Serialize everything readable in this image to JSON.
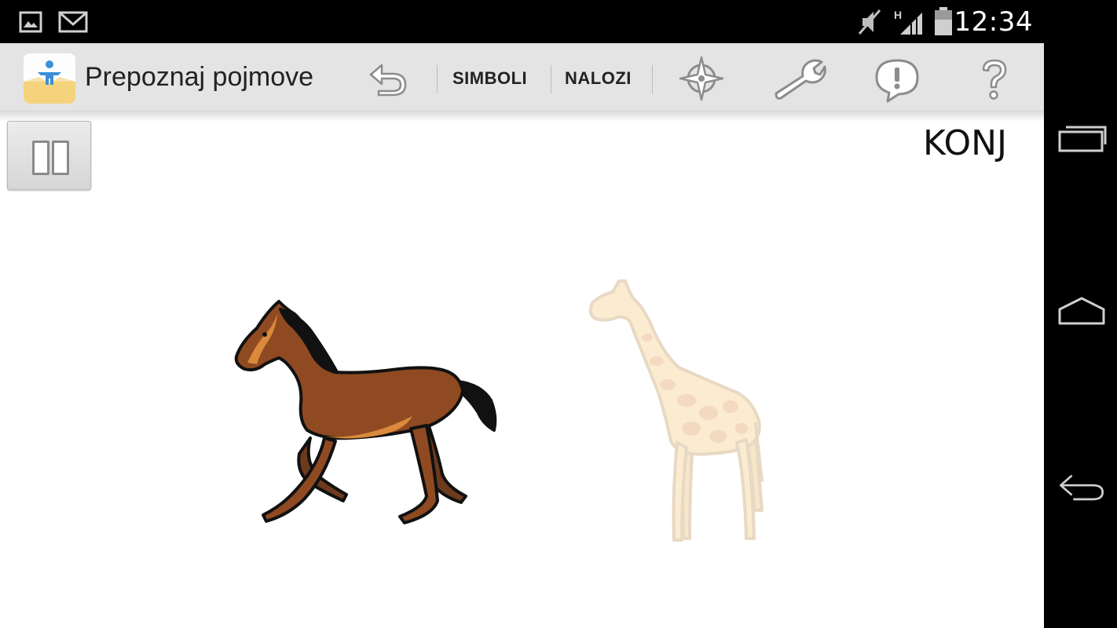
{
  "status_bar": {
    "time": "12:34",
    "icons": [
      "gallery-notification-icon",
      "gmail-notification-icon",
      "mute-icon",
      "signal-h-icon",
      "battery-icon"
    ]
  },
  "action_bar": {
    "app_title": "Prepoznaj pojmove",
    "symbols_label": "SIMBOLI",
    "tasks_label": "NALOZI",
    "icons": [
      "undo-icon",
      "compass-icon",
      "wrench-icon",
      "alert-icon",
      "help-icon"
    ]
  },
  "main": {
    "target_word": "KONJ",
    "symbols": [
      {
        "name": "horse",
        "state": "active"
      },
      {
        "name": "giraffe",
        "state": "faded"
      }
    ]
  },
  "nav_bar": {
    "icons": [
      "recent-apps-icon",
      "home-icon",
      "back-icon"
    ]
  }
}
